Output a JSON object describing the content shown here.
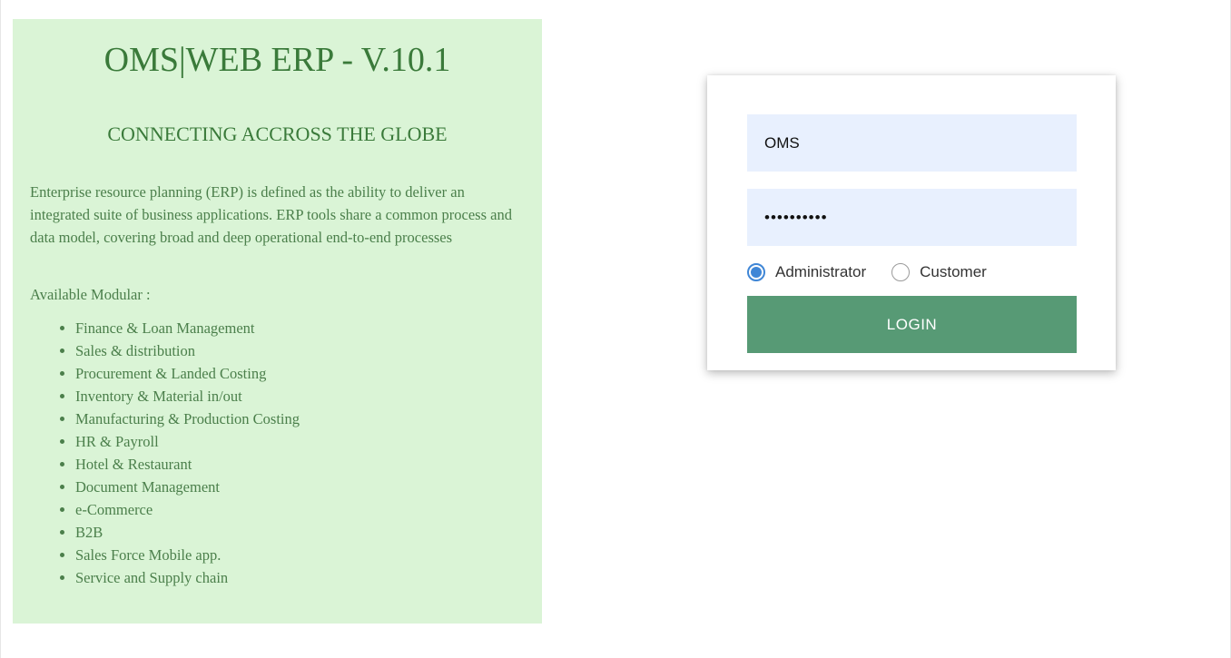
{
  "info": {
    "title": "OMS|WEB ERP - V.10.1",
    "subtitle": "CONNECTING ACCROSS THE GLOBE",
    "description": "Enterprise resource planning (ERP) is defined as the ability to deliver an integrated suite of business applications. ERP tools share a common process and data model, covering broad and deep operational end-to-end processes",
    "modules_heading": "Available Modular :",
    "modules": [
      "Finance & Loan Management",
      "Sales & distribution",
      "Procurement & Landed Costing",
      "Inventory & Material in/out",
      "Manufacturing & Production Costing",
      "HR & Payroll",
      "Hotel & Restaurant",
      "Document Management",
      "e-Commerce",
      "B2B",
      "Sales Force Mobile app.",
      "Service and Supply chain"
    ]
  },
  "login": {
    "username_value": "OMS",
    "password_value": "••••••••••",
    "roles": [
      {
        "label": "Administrator",
        "checked": true
      },
      {
        "label": "Customer",
        "checked": false
      }
    ],
    "button_label": "LOGIN"
  },
  "colors": {
    "panel_bg": "#daf4d6",
    "panel_text": "#3a7a3a",
    "input_bg": "#e8f0fe",
    "button_bg": "#579a75",
    "radio_accent": "#3f86d6"
  }
}
